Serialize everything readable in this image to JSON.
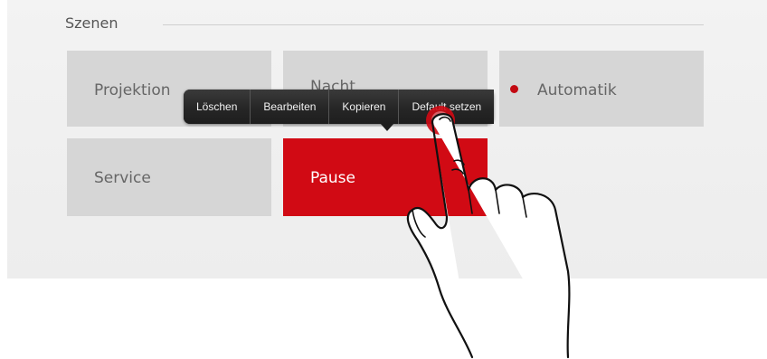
{
  "scenes": {
    "title": "Szenen",
    "tiles": [
      {
        "label": "Projektion"
      },
      {
        "label": "Nacht"
      },
      {
        "label": "Automatik"
      },
      {
        "label": "Service"
      },
      {
        "label": "Pause"
      }
    ]
  },
  "context_menu": {
    "items": [
      {
        "label": "Löschen"
      },
      {
        "label": "Bearbeiten"
      },
      {
        "label": "Kopieren"
      },
      {
        "label": "Default setzen"
      }
    ]
  },
  "colors": {
    "accent": "#d10a14",
    "tile_background": "#d6d6d6",
    "menu_background": "#2a2a2a"
  },
  "icons": {
    "status_indicator": "red-dot-icon",
    "gesture": "pointing-hand-icon",
    "touch_point": "touch-indicator-icon"
  }
}
